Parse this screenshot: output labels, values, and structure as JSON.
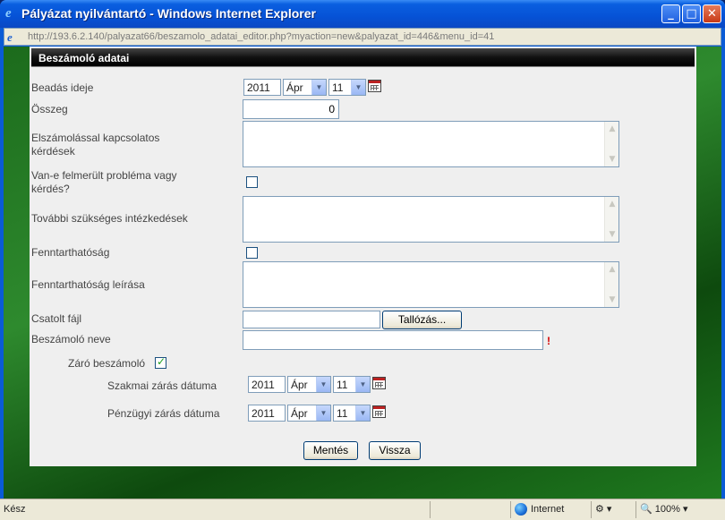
{
  "window": {
    "title": "Pályázat nyilvántartó - Windows Internet Explorer",
    "url_host": "http://193.6.2.140",
    "url_path": "/palyazat66/beszamolo_adatai_editor.php?myaction=new&palyazat_id=446&menu_id=41"
  },
  "form": {
    "header": "Beszámoló adatai",
    "beadas_label": "Beadás ideje",
    "beadas_year": "2011",
    "beadas_month": "Ápr",
    "beadas_day": "11",
    "osszeg_label": "Összeg",
    "osszeg_value": "0",
    "elszamolas_label_1": "Elszámolással kapcsolatos",
    "elszamolas_label_2": "kérdések",
    "problema_label_1": "Van-e felmerült probléma vagy",
    "problema_label_2": "kérdés?",
    "intezkedesek_label": "További szükséges intézkedések",
    "fenntarthatosag_label": "Fenntarthatóság",
    "fenntarthatosag_leiras_label": "Fenntarthatóság leírása",
    "csatolt_label": "Csatolt fájl",
    "browse_button": "Tallózás...",
    "nev_label": "Beszámoló neve",
    "required_mark": "!",
    "zaro_label": "Záró beszámoló",
    "zaro_checked": true,
    "szakmai_label": "Szakmai zárás dátuma",
    "szakmai_year": "2011",
    "szakmai_month": "Ápr",
    "szakmai_day": "11",
    "penzugyi_label": "Pénzügyi zárás dátuma",
    "penzugyi_year": "2011",
    "penzugyi_month": "Ápr",
    "penzugyi_day": "11",
    "save_button": "Mentés",
    "back_button": "Vissza"
  },
  "statusbar": {
    "status": "Kész",
    "zone": "Internet",
    "zoom": "100%"
  }
}
